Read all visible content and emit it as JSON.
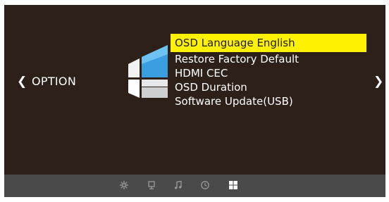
{
  "nav": {
    "left_arrow": "❮",
    "right_arrow": "❯",
    "section_title": "OPTION"
  },
  "menu": {
    "selected_index": 0,
    "items": [
      {
        "label": "OSD Language English"
      },
      {
        "label": "Restore Factory Default"
      },
      {
        "label": "HDMI CEC"
      },
      {
        "label": "OSD Duration"
      },
      {
        "label": "Software Update(USB)"
      }
    ]
  },
  "footer": {
    "tabs": [
      {
        "icon": "brightness-icon",
        "active": false
      },
      {
        "icon": "monitor-icon",
        "active": false
      },
      {
        "icon": "music-note-icon",
        "active": false
      },
      {
        "icon": "clock-icon",
        "active": false
      },
      {
        "icon": "windows-grid-icon",
        "active": true
      }
    ]
  },
  "colors": {
    "background": "#2c2019",
    "highlight": "#fff200",
    "footer": "#4a4a4a",
    "text": "#ffffff",
    "icon_inactive": "#9a9a9a",
    "icon_active": "#ffffff"
  }
}
